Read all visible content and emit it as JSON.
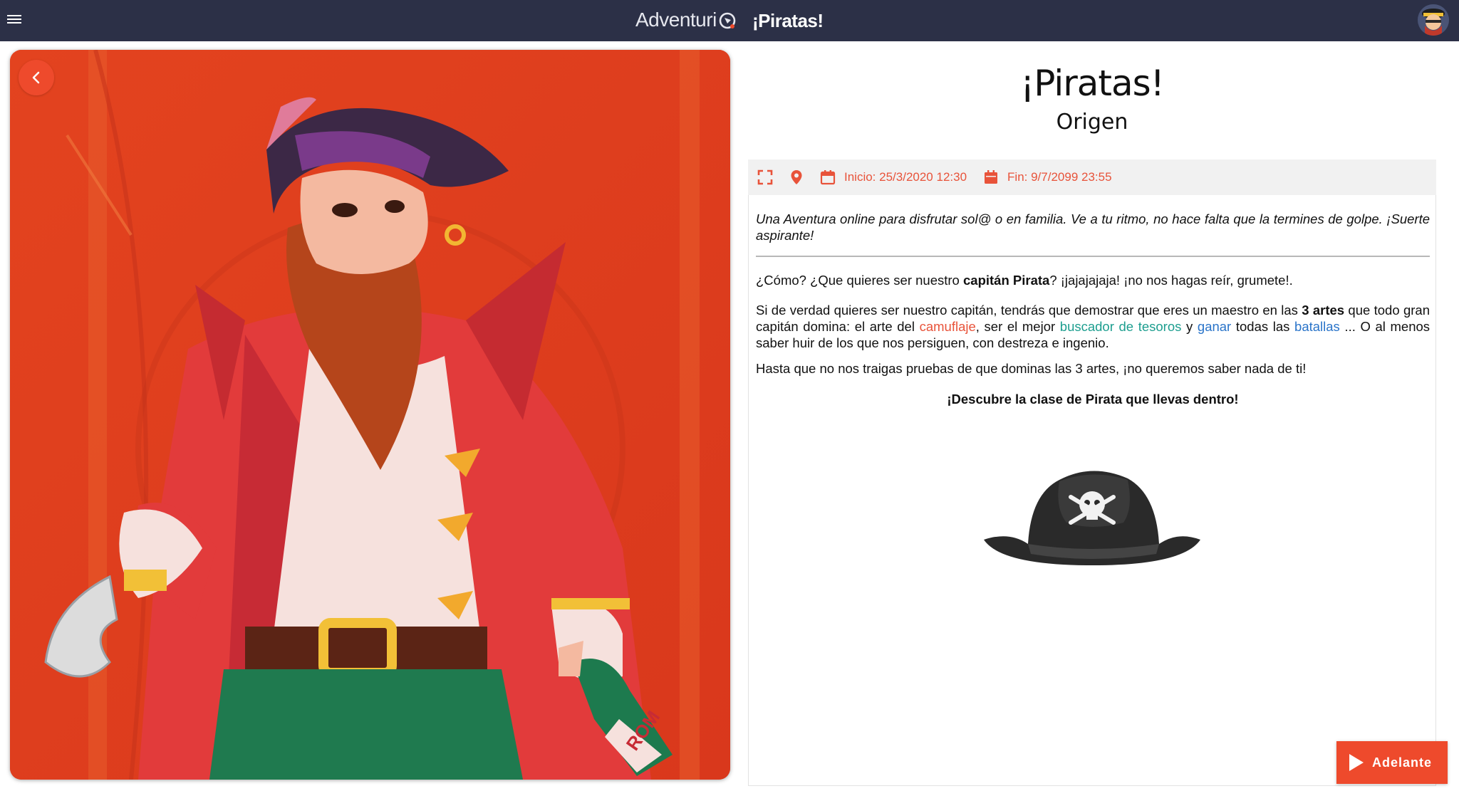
{
  "topbar": {
    "brand": "Adventuri",
    "title": "¡Piratas!",
    "menu_icon": "hamburger-menu-icon",
    "avatar_icon": "pirate-avatar"
  },
  "hero": {
    "image": "pirate-captain-illustration",
    "bottle_label": "ROM",
    "back_icon": "chevron-left-icon"
  },
  "detail": {
    "title": "¡Piratas!",
    "subtitle": "Origen",
    "info": {
      "fullscreen_icon": "fullscreen-icon",
      "location_icon": "map-pin-icon",
      "start_icon": "calendar-outline-icon",
      "start_label": "Inicio: 25/3/2020 12:30",
      "end_icon": "calendar-filled-icon",
      "end_label": "Fin: 9/7/2099 23:55"
    },
    "intro": "Una Aventura online para disfrutar sol@ o en familia. Ve a tu ritmo, no hace falta que la termines de golpe. ¡Suerte aspirante!",
    "p1": {
      "a": "¿Cómo? ¿Que quieres ser nuestro ",
      "b": "capitán Pirata",
      "c": "? ¡jajajajaja! ¡no nos hagas reír, grumete!."
    },
    "p2": {
      "a": "Si de verdad quieres ser nuestro capitán, tendrás que demostrar que eres un maestro en las ",
      "b": "3 artes",
      "c": " que todo gran capitán domina: el arte del ",
      "d": "camuflaje",
      "e": ", ser el mejor ",
      "f": "buscador de tesoros",
      "g": " y ",
      "h": "ganar",
      "i": " todas las ",
      "j": "batallas",
      "k": " ... O al menos saber huir de los que nos persiguen, con destreza e ingenio."
    },
    "p3": "Hasta que no nos traigas pruebas de que dominas las 3 artes, ¡no queremos saber nada de ti!",
    "p4": "¡Descubre la clase de Pirata que llevas dentro!",
    "hat_image": "pirate-hat-skull"
  },
  "actions": {
    "next_label": "Adelante",
    "next_icon": "play-icon"
  },
  "colors": {
    "topbar": "#2c3047",
    "accent": "#ee4a2c",
    "teal": "#1d9e8f",
    "blue": "#2a74c9"
  }
}
